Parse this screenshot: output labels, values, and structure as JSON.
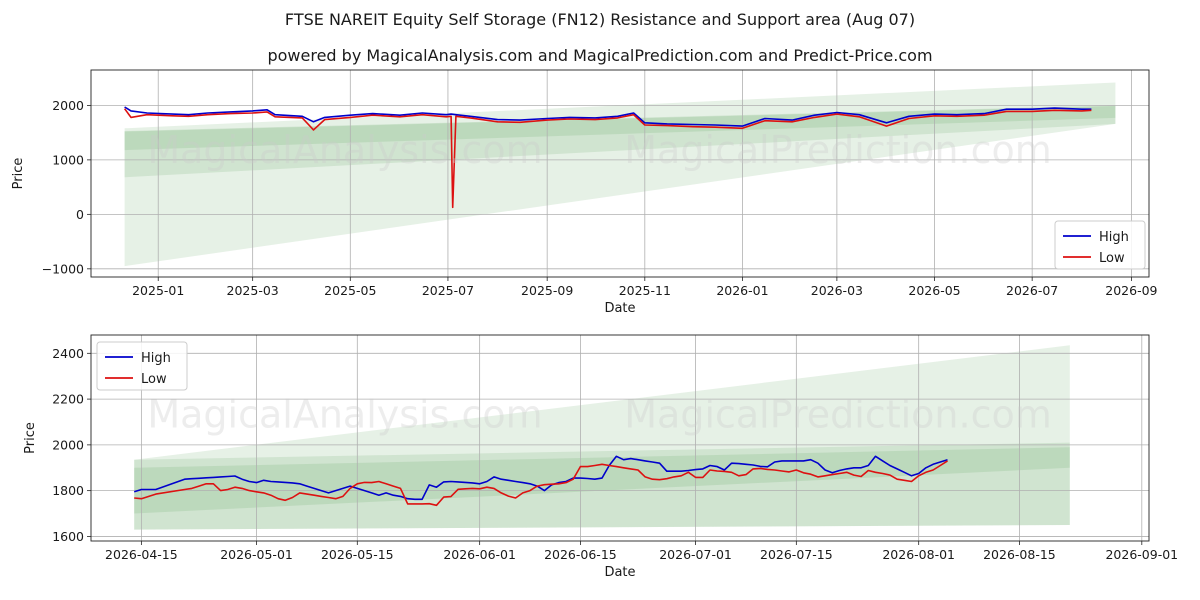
{
  "title": "FTSE NAREIT Equity Self Storage (FN12) Resistance and Support area (Aug 07)",
  "subtitle": "powered by MagicalAnalysis.com and MagicalPrediction.com and Predict-Price.com",
  "watermarks": [
    "MagicalAnalysis.com",
    "MagicalPrediction.com"
  ],
  "colors": {
    "high": "#0000cc",
    "low": "#dd1111",
    "band": "#2e8b2e",
    "grid": "#b0b0b0"
  },
  "chart_data": [
    {
      "type": "line",
      "xlabel": "Date",
      "ylabel": "Price",
      "xlim": [
        "2024-11-20",
        "2026-09-12"
      ],
      "ylim": [
        -1150,
        2650
      ],
      "x_ticks": [
        "2025-01",
        "2025-03",
        "2025-05",
        "2025-07",
        "2025-09",
        "2025-11",
        "2026-01",
        "2026-03",
        "2026-05",
        "2026-07",
        "2026-09"
      ],
      "x_tick_dates": [
        "2025-01-01",
        "2025-03-01",
        "2025-05-01",
        "2025-07-01",
        "2025-09-01",
        "2025-11-01",
        "2026-01-01",
        "2026-03-01",
        "2026-05-01",
        "2026-07-01",
        "2026-09-01"
      ],
      "y_ticks": [
        -1000,
        0,
        1000,
        2000
      ],
      "y_tick_labels": [
        "−1000",
        "0",
        "1000",
        "2000"
      ],
      "grid": true,
      "legend": "lower right",
      "series": [
        {
          "name": "High",
          "color": "#0000cc",
          "x": [
            "2024-12-11",
            "2024-12-15",
            "2024-12-25",
            "2025-01-10",
            "2025-01-20",
            "2025-02-01",
            "2025-02-15",
            "2025-03-01",
            "2025-03-10",
            "2025-03-15",
            "2025-04-01",
            "2025-04-08",
            "2025-04-15",
            "2025-05-01",
            "2025-05-15",
            "2025-06-01",
            "2025-06-15",
            "2025-06-30",
            "2025-07-03",
            "2025-07-06",
            "2025-07-15",
            "2025-08-01",
            "2025-08-15",
            "2025-09-01",
            "2025-09-15",
            "2025-10-01",
            "2025-10-15",
            "2025-10-25",
            "2025-11-01",
            "2025-11-15",
            "2025-12-01",
            "2025-12-15",
            "2026-01-01",
            "2026-01-15",
            "2026-02-01",
            "2026-02-15",
            "2026-03-01",
            "2026-03-15",
            "2026-04-01",
            "2026-04-15",
            "2026-05-01",
            "2026-05-15",
            "2026-06-01",
            "2026-06-15",
            "2026-07-01",
            "2026-07-15",
            "2026-08-01",
            "2026-08-07"
          ],
          "y": [
            1970,
            1900,
            1860,
            1840,
            1830,
            1860,
            1880,
            1900,
            1920,
            1830,
            1800,
            1700,
            1780,
            1820,
            1850,
            1820,
            1860,
            1830,
            1840,
            1830,
            1800,
            1740,
            1730,
            1760,
            1780,
            1770,
            1800,
            1860,
            1680,
            1660,
            1650,
            1640,
            1620,
            1760,
            1730,
            1820,
            1870,
            1830,
            1680,
            1800,
            1840,
            1830,
            1850,
            1930,
            1930,
            1950,
            1930,
            1930
          ]
        },
        {
          "name": "Low",
          "color": "#dd1111",
          "x": [
            "2024-12-11",
            "2024-12-15",
            "2024-12-25",
            "2025-01-10",
            "2025-01-20",
            "2025-02-01",
            "2025-02-15",
            "2025-03-01",
            "2025-03-10",
            "2025-03-15",
            "2025-04-01",
            "2025-04-08",
            "2025-04-15",
            "2025-05-01",
            "2025-05-15",
            "2025-06-01",
            "2025-06-15",
            "2025-06-30",
            "2025-07-03",
            "2025-07-04",
            "2025-07-06",
            "2025-07-15",
            "2025-08-01",
            "2025-08-15",
            "2025-09-01",
            "2025-09-15",
            "2025-10-01",
            "2025-10-15",
            "2025-10-25",
            "2025-11-01",
            "2025-11-15",
            "2025-12-01",
            "2025-12-15",
            "2026-01-01",
            "2026-01-15",
            "2026-02-01",
            "2026-02-15",
            "2026-03-01",
            "2026-03-15",
            "2026-04-01",
            "2026-04-15",
            "2026-05-01",
            "2026-05-15",
            "2026-06-01",
            "2026-06-15",
            "2026-07-01",
            "2026-07-15",
            "2026-08-01",
            "2026-08-07"
          ],
          "y": [
            1940,
            1780,
            1830,
            1810,
            1800,
            1830,
            1850,
            1860,
            1880,
            1790,
            1770,
            1550,
            1740,
            1780,
            1820,
            1790,
            1830,
            1790,
            1800,
            130,
            1800,
            1770,
            1700,
            1690,
            1730,
            1750,
            1740,
            1770,
            1830,
            1640,
            1630,
            1610,
            1600,
            1580,
            1720,
            1700,
            1780,
            1840,
            1790,
            1620,
            1760,
            1810,
            1800,
            1820,
            1890,
            1890,
            1910,
            1900,
            1910
          ]
        }
      ],
      "bands": [
        {
          "x": [
            "2024-12-11",
            "2026-08-22"
          ],
          "upper": [
            1520,
            1990
          ],
          "lower": [
            680,
            1660
          ]
        },
        {
          "x": [
            "2024-12-11",
            "2026-08-22"
          ],
          "upper": [
            1580,
            2420
          ],
          "lower": [
            -950,
            1660
          ]
        },
        {
          "x": [
            "2024-12-11",
            "2026-08-22"
          ],
          "upper": [
            1530,
            2000
          ],
          "lower": [
            1180,
            1770
          ]
        }
      ]
    },
    {
      "type": "line",
      "xlabel": "Date",
      "ylabel": "Price",
      "xlim": [
        "2026-04-08",
        "2026-09-02"
      ],
      "ylim": [
        1580,
        2480
      ],
      "x_ticks": [
        "2026-04-15",
        "2026-05-01",
        "2026-05-15",
        "2026-06-01",
        "2026-06-15",
        "2026-07-01",
        "2026-07-15",
        "2026-08-01",
        "2026-08-15",
        "2026-09-01"
      ],
      "y_ticks": [
        1600,
        1800,
        2000,
        2200,
        2400
      ],
      "grid": true,
      "legend": "upper left",
      "series": [
        {
          "name": "High",
          "color": "#0000cc",
          "x": [
            "2026-04-14",
            "2026-04-15",
            "2026-04-17",
            "2026-04-21",
            "2026-04-22",
            "2026-04-23",
            "2026-04-24",
            "2026-04-25",
            "2026-04-26",
            "2026-04-27",
            "2026-04-28",
            "2026-04-29",
            "2026-04-30",
            "2026-05-01",
            "2026-05-02",
            "2026-05-03",
            "2026-05-04",
            "2026-05-05",
            "2026-05-06",
            "2026-05-07",
            "2026-05-08",
            "2026-05-09",
            "2026-05-10",
            "2026-05-11",
            "2026-05-12",
            "2026-05-13",
            "2026-05-14",
            "2026-05-15",
            "2026-05-16",
            "2026-05-17",
            "2026-05-18",
            "2026-05-19",
            "2026-05-20",
            "2026-05-21",
            "2026-05-22",
            "2026-05-23",
            "2026-05-24",
            "2026-05-25",
            "2026-05-26",
            "2026-05-27",
            "2026-05-28",
            "2026-05-29",
            "2026-05-30",
            "2026-05-31",
            "2026-06-01",
            "2026-06-02",
            "2026-06-03",
            "2026-06-04",
            "2026-06-05",
            "2026-06-06",
            "2026-06-07",
            "2026-06-08",
            "2026-06-09",
            "2026-06-10",
            "2026-06-11",
            "2026-06-12",
            "2026-06-13",
            "2026-06-14",
            "2026-06-15",
            "2026-06-16",
            "2026-06-17",
            "2026-06-18",
            "2026-06-19",
            "2026-06-20",
            "2026-06-21",
            "2026-06-22",
            "2026-06-23",
            "2026-06-24",
            "2026-06-25",
            "2026-06-26",
            "2026-06-27",
            "2026-06-28",
            "2026-06-29",
            "2026-06-30",
            "2026-07-01",
            "2026-07-02",
            "2026-07-03",
            "2026-07-04",
            "2026-07-05",
            "2026-07-06",
            "2026-07-07",
            "2026-07-08",
            "2026-07-09",
            "2026-07-10",
            "2026-07-11",
            "2026-07-12",
            "2026-07-13",
            "2026-07-14",
            "2026-07-15",
            "2026-07-16",
            "2026-07-17",
            "2026-07-18",
            "2026-07-19",
            "2026-07-20",
            "2026-07-21",
            "2026-07-22",
            "2026-07-23",
            "2026-07-24",
            "2026-07-25",
            "2026-07-26",
            "2026-07-27",
            "2026-07-28",
            "2026-07-29",
            "2026-07-30",
            "2026-07-31",
            "2026-08-01",
            "2026-08-02",
            "2026-08-03",
            "2026-08-04",
            "2026-08-05"
          ],
          "y": [
            1795,
            1805,
            1805,
            1850,
            1852,
            1854,
            1856,
            1858,
            1860,
            1862,
            1864,
            1850,
            1840,
            1835,
            1845,
            1840,
            1838,
            1836,
            1834,
            1830,
            1820,
            1810,
            1800,
            1790,
            1800,
            1810,
            1820,
            1810,
            1800,
            1790,
            1780,
            1790,
            1780,
            1775,
            1765,
            1762,
            1762,
            1825,
            1815,
            1838,
            1840,
            1838,
            1836,
            1834,
            1830,
            1840,
            1860,
            1850,
            1845,
            1840,
            1835,
            1830,
            1820,
            1800,
            1825,
            1835,
            1840,
            1855,
            1855,
            1853,
            1850,
            1855,
            1910,
            1950,
            1935,
            1940,
            1935,
            1930,
            1925,
            1920,
            1885,
            1885,
            1885,
            1888,
            1892,
            1895,
            1910,
            1905,
            1890,
            1920,
            1918,
            1915,
            1912,
            1906,
            1904,
            1925,
            1930,
            1930,
            1930,
            1930,
            1935,
            1920,
            1890,
            1878,
            1888,
            1895,
            1900,
            1900,
            1910,
            1950,
            1930,
            1910,
            1895,
            1880,
            1865,
            1875,
            1900,
            1915,
            1925,
            1935
          ]
        },
        {
          "name": "Low",
          "color": "#dd1111",
          "x": [
            "2026-04-14",
            "2026-04-15",
            "2026-04-17",
            "2026-04-21",
            "2026-04-22",
            "2026-04-23",
            "2026-04-24",
            "2026-04-25",
            "2026-04-26",
            "2026-04-27",
            "2026-04-28",
            "2026-04-29",
            "2026-04-30",
            "2026-05-01",
            "2026-05-02",
            "2026-05-03",
            "2026-05-04",
            "2026-05-05",
            "2026-05-06",
            "2026-05-07",
            "2026-05-08",
            "2026-05-09",
            "2026-05-10",
            "2026-05-11",
            "2026-05-12",
            "2026-05-13",
            "2026-05-14",
            "2026-05-15",
            "2026-05-16",
            "2026-05-17",
            "2026-05-18",
            "2026-05-19",
            "2026-05-20",
            "2026-05-21",
            "2026-05-22",
            "2026-05-23",
            "2026-05-24",
            "2026-05-25",
            "2026-05-26",
            "2026-05-27",
            "2026-05-28",
            "2026-05-29",
            "2026-05-30",
            "2026-05-31",
            "2026-06-01",
            "2026-06-02",
            "2026-06-03",
            "2026-06-04",
            "2026-06-05",
            "2026-06-06",
            "2026-06-07",
            "2026-06-08",
            "2026-06-09",
            "2026-06-10",
            "2026-06-11",
            "2026-06-12",
            "2026-06-13",
            "2026-06-14",
            "2026-06-15",
            "2026-06-16",
            "2026-06-17",
            "2026-06-18",
            "2026-06-19",
            "2026-06-20",
            "2026-06-21",
            "2026-06-22",
            "2026-06-23",
            "2026-06-24",
            "2026-06-25",
            "2026-06-26",
            "2026-06-27",
            "2026-06-28",
            "2026-06-29",
            "2026-06-30",
            "2026-07-01",
            "2026-07-02",
            "2026-07-03",
            "2026-07-04",
            "2026-07-05",
            "2026-07-06",
            "2026-07-07",
            "2026-07-08",
            "2026-07-09",
            "2026-07-10",
            "2026-07-11",
            "2026-07-12",
            "2026-07-13",
            "2026-07-14",
            "2026-07-15",
            "2026-07-16",
            "2026-07-17",
            "2026-07-18",
            "2026-07-19",
            "2026-07-20",
            "2026-07-21",
            "2026-07-22",
            "2026-07-23",
            "2026-07-24",
            "2026-07-25",
            "2026-07-26",
            "2026-07-27",
            "2026-07-28",
            "2026-07-29",
            "2026-07-30",
            "2026-07-31",
            "2026-08-01",
            "2026-08-02",
            "2026-08-03",
            "2026-08-04",
            "2026-08-05"
          ],
          "y": [
            1768,
            1765,
            1785,
            1805,
            1810,
            1820,
            1830,
            1830,
            1800,
            1805,
            1815,
            1810,
            1800,
            1795,
            1790,
            1780,
            1765,
            1758,
            1770,
            1790,
            1785,
            1780,
            1775,
            1770,
            1765,
            1775,
            1810,
            1830,
            1836,
            1835,
            1840,
            1830,
            1820,
            1810,
            1742,
            1742,
            1742,
            1743,
            1736,
            1772,
            1774,
            1806,
            1808,
            1810,
            1808,
            1815,
            1810,
            1790,
            1776,
            1768,
            1790,
            1800,
            1820,
            1826,
            1828,
            1830,
            1835,
            1850,
            1905,
            1905,
            1910,
            1915,
            1910,
            1905,
            1900,
            1895,
            1890,
            1860,
            1850,
            1848,
            1852,
            1860,
            1865,
            1880,
            1858,
            1858,
            1890,
            1886,
            1884,
            1880,
            1865,
            1870,
            1895,
            1897,
            1893,
            1890,
            1886,
            1882,
            1890,
            1878,
            1872,
            1860,
            1865,
            1870,
            1875,
            1880,
            1868,
            1862,
            1888,
            1880,
            1875,
            1868,
            1850,
            1845,
            1840,
            1865,
            1880,
            1890,
            1910,
            1930
          ]
        }
      ],
      "bands": [
        {
          "x": [
            "2026-04-14",
            "2026-08-22"
          ],
          "upper": [
            1935,
            2010
          ],
          "lower": [
            1630,
            1650
          ]
        },
        {
          "x": [
            "2026-04-14",
            "2026-08-22"
          ],
          "upper": [
            1935,
            2435
          ],
          "lower": [
            1630,
            1650
          ]
        },
        {
          "x": [
            "2026-04-14",
            "2026-08-22"
          ],
          "upper": [
            1900,
            1990
          ],
          "lower": [
            1700,
            1900
          ]
        }
      ]
    }
  ]
}
